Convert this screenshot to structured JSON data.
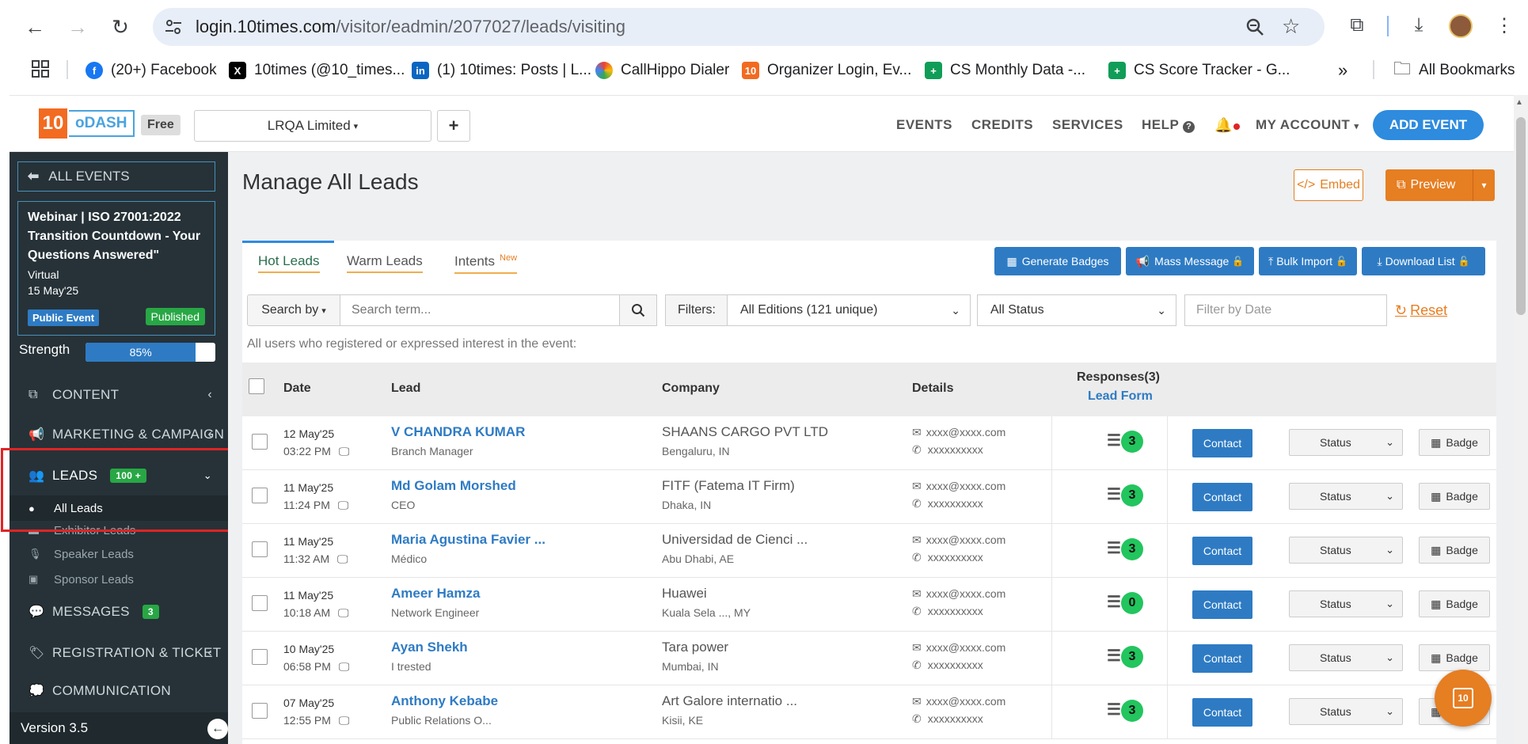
{
  "browser": {
    "url_host": "login.10times.com",
    "url_path": "/visitor/eadmin/2077027/leads/visiting",
    "bookmarks": [
      {
        "label": "(20+) Facebook",
        "icon": "facebook-icon",
        "color": "#1877f2"
      },
      {
        "label": "10times (@10_times...",
        "icon": "x-icon",
        "color": "#000000"
      },
      {
        "label": "(1) 10times: Posts | L...",
        "icon": "linkedin-icon",
        "color": "#0a66c2"
      },
      {
        "label": "CallHippo Dialer",
        "icon": "callhippo-icon",
        "color": "#f4b400"
      },
      {
        "label": "Organizer Login, Ev...",
        "icon": "10times-icon",
        "color": "#f26b21"
      },
      {
        "label": "CS Monthly Data -...",
        "icon": "sheets-icon",
        "color": "#0f9d58"
      },
      {
        "label": "CS Score Tracker - G...",
        "icon": "sheets-icon",
        "color": "#0f9d58"
      }
    ],
    "all_bookmarks": "All Bookmarks"
  },
  "header": {
    "logo_num": "10",
    "logo_text": "oDASH",
    "plan": "Free",
    "org": "LRQA Limited",
    "nav": [
      "EVENTS",
      "CREDITS",
      "SERVICES",
      "HELP",
      "MY ACCOUNT"
    ],
    "add_event": "ADD EVENT"
  },
  "sidebar": {
    "all_events": "ALL EVENTS",
    "event_title": "Webinar | ISO 27001:2022 Transition Countdown - Your Questions Answered\"",
    "event_mode": "Virtual",
    "event_date": "15 May'25",
    "public_event": "Public Event",
    "published": "Published",
    "strength_label": "Strength",
    "strength_value": "85%",
    "strength_fraction": 0.85,
    "content": "CONTENT",
    "marketing": "MARKETING & CAMPAIGN",
    "leads": "LEADS",
    "leads_badge": "100 +",
    "all_leads": "All Leads",
    "exhibitor_leads": "Exhibitor Leads",
    "speaker_leads": "Speaker Leads",
    "sponsor_leads": "Sponsor Leads",
    "messages": "MESSAGES",
    "messages_badge": "3",
    "registration": "REGISTRATION & TICKET",
    "communication": "COMMUNICATION",
    "version": "Version 3.5"
  },
  "main": {
    "title": "Manage All Leads",
    "embed": "Embed",
    "preview": "Preview",
    "tabs": {
      "hot": "Hot Leads",
      "warm": "Warm Leads",
      "intents": "Intents",
      "new": "New"
    },
    "actions": {
      "badges": "Generate Badges",
      "mass": "Mass Message",
      "bulk": "Bulk Import",
      "download": "Download List"
    },
    "search_by": "Search by",
    "search_placeholder": "Search term...",
    "filters_label": "Filters:",
    "editions": "All Editions (121 unique)",
    "status_filter": "All Status",
    "date_placeholder": "Filter by Date",
    "reset": "Reset",
    "help": "All users who registered or expressed interest in the event:",
    "columns": {
      "date": "Date",
      "lead": "Lead",
      "company": "Company",
      "details": "Details",
      "responses": "Responses(3)",
      "lead_form": "Lead Form"
    },
    "row_buttons": {
      "contact": "Contact",
      "status": "Status",
      "badge": "Badge"
    },
    "rows": [
      {
        "date": "12 May'25",
        "time": "03:22 PM",
        "name": "V CHANDRA KUMAR",
        "role": "Branch Manager",
        "company": "SHAANS CARGO PVT LTD",
        "location": "Bengaluru, IN",
        "email": "xxxx@xxxx.com",
        "phone": "xxxxxxxxxx",
        "responses": "3"
      },
      {
        "date": "11 May'25",
        "time": "11:24 PM",
        "name": "Md Golam Morshed",
        "role": "CEO",
        "company": "FITF (Fatema IT Firm)",
        "location": "Dhaka, IN",
        "email": "xxxx@xxxx.com",
        "phone": "xxxxxxxxxx",
        "responses": "3"
      },
      {
        "date": "11 May'25",
        "time": "11:32 AM",
        "name": "Maria Agustina Favier ...",
        "role": "Médico",
        "company": "Universidad de Cienci ...",
        "location": "Abu Dhabi, AE",
        "email": "xxxx@xxxx.com",
        "phone": "xxxxxxxxxx",
        "responses": "3"
      },
      {
        "date": "11 May'25",
        "time": "10:18 AM",
        "name": "Ameer Hamza",
        "role": "Network Engineer",
        "company": "Huawei",
        "location": "Kuala Sela ..., MY",
        "email": "xxxx@xxxx.com",
        "phone": "xxxxxxxxxx",
        "responses": "0"
      },
      {
        "date": "10 May'25",
        "time": "06:58 PM",
        "name": "Ayan Shekh",
        "role": "I trested",
        "company": "Tara power",
        "location": "Mumbai, IN",
        "email": "xxxx@xxxx.com",
        "phone": "xxxxxxxxxx",
        "responses": "3"
      },
      {
        "date": "07 May'25",
        "time": "12:55 PM",
        "name": "Anthony Kebabe",
        "role": "Public Relations O...",
        "company": "Art Galore internatio ...",
        "location": "Kisii, KE",
        "email": "xxxx@xxxx.com",
        "phone": "xxxxxxxxxx",
        "responses": "3"
      }
    ]
  },
  "fab_label": "10",
  "colors": {
    "accent": "#2e7bc4",
    "orange": "#e67e22",
    "sidebar": "#263238",
    "green": "#28a745"
  }
}
